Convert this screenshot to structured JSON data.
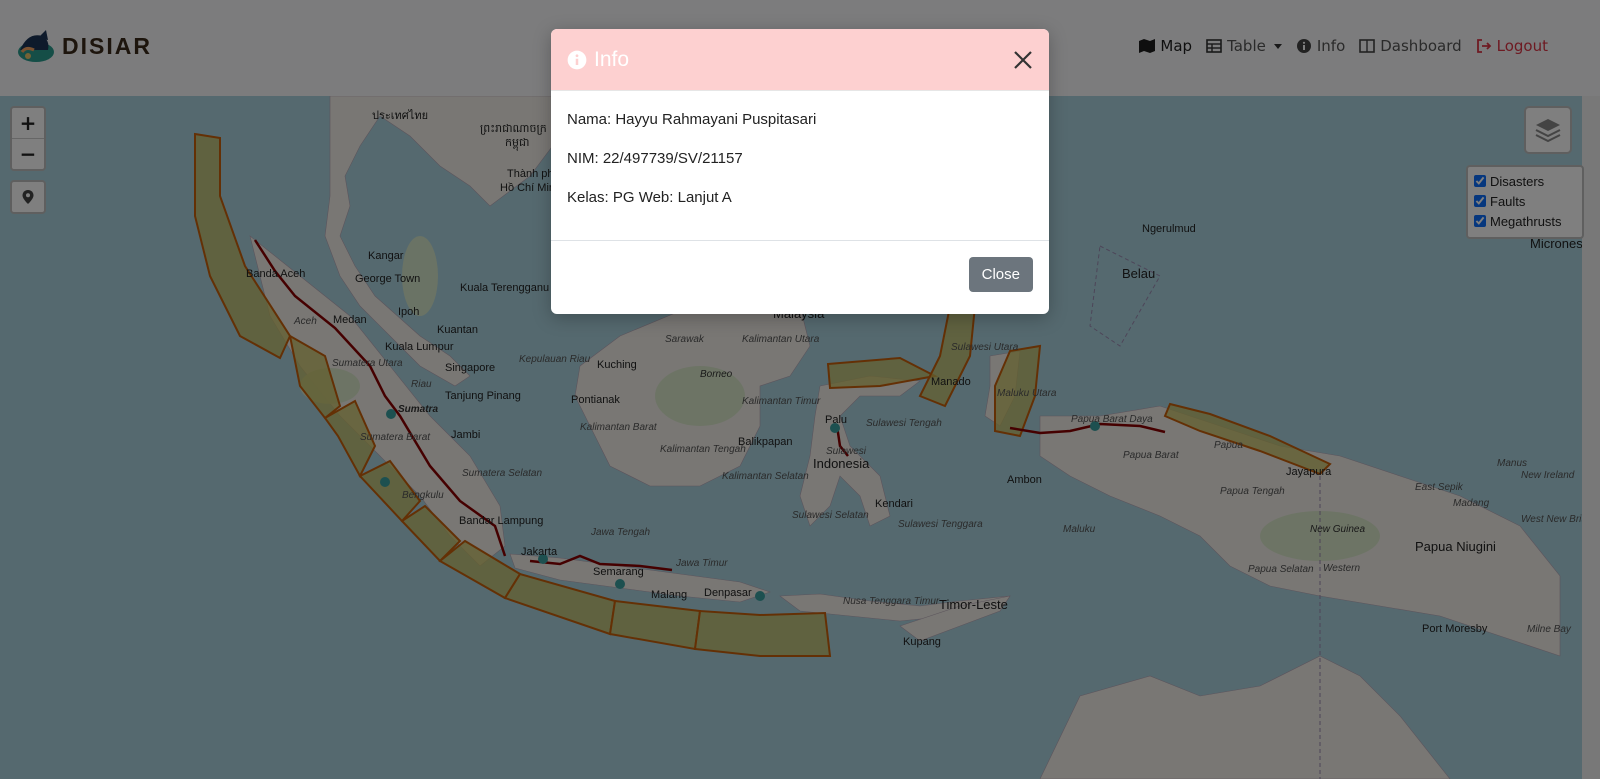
{
  "brand": {
    "name": "DISIAR"
  },
  "nav": {
    "items": [
      {
        "label": "Map",
        "icon": "map-icon"
      },
      {
        "label": "Table",
        "icon": "table-icon"
      },
      {
        "label": "Info",
        "icon": "info-circle-icon"
      },
      {
        "label": "Dashboard",
        "icon": "dashboard-icon"
      },
      {
        "label": "Logout",
        "icon": "logout-icon"
      }
    ]
  },
  "map": {
    "zoom_in": "+",
    "zoom_out": "−",
    "layers": [
      {
        "label": "Disasters",
        "checked": true
      },
      {
        "label": "Faults",
        "checked": true
      },
      {
        "label": "Megathrusts",
        "checked": true
      }
    ],
    "labels": {
      "thailand": "ประเทศไทย",
      "cambodia": "ព្រះរាជាណាចក្រ",
      "cambodia2": "កម្ពុជា",
      "hcm": "Thành phố",
      "hcm2": "Hồ Chí Minh",
      "banda_aceh": "Banda Aceh",
      "aceh_prov": "Aceh",
      "kangar": "Kangar",
      "george_town": "George Town",
      "ipoh": "Ipoh",
      "kuala_terengganu": "Kuala Terengganu",
      "medan": "Medan",
      "kuantan": "Kuantan",
      "kuala_lumpur": "Kuala Lumpur",
      "sumatera_utara": "Sumatera Utara",
      "singapore": "Singapore",
      "riau": "Riau",
      "kepulauan_riau": "Kepulauan Riau",
      "tanjung_pinang": "Tanjung Pinang",
      "sumatra": "Sumatra",
      "jambi": "Jambi",
      "sumatera_barat": "Sumatera Barat",
      "bengkulu": "Bengkulu",
      "sumatera_selatan": "Sumatera Selatan",
      "bandar_lampung": "Bandar Lampung",
      "jakarta": "Jakarta",
      "jawa_tengah": "Jawa Tengah",
      "semarang": "Semarang",
      "jawa_timur": "Jawa Timur",
      "malang": "Malang",
      "denpasar": "Denpasar",
      "kuching": "Kuching",
      "sarawak": "Sarawak",
      "borneo": "Borneo",
      "pontianak": "Pontianak",
      "kalimantan_barat": "Kalimantan Barat",
      "kalimantan_tengah": "Kalimantan Tengah",
      "kalimantan_timur": "Kalimantan Timur",
      "kalimantan_selatan": "Kalimantan Selatan",
      "kalimantan_utara": "Kalimantan Utara",
      "balikpapan": "Balikpapan",
      "malaysia": "Malaysia",
      "palu": "Palu",
      "sulawesi_tengah": "Sulawesi Tengah",
      "sulawesi_utara": "Sulawesi Utara",
      "sulawesi": "Sulawesi",
      "indonesia": "Indonesia",
      "kendari": "Kendari",
      "sulawesi_selatan": "Sulawesi Selatan",
      "sulawesi_tenggara": "Sulawesi Tenggara",
      "nusa_tenggara_timur": "Nusa Tenggara Timur",
      "timor_leste": "Timor-Leste",
      "kupang": "Kupang",
      "manado": "Manado",
      "maluku_utara": "Maluku Utara",
      "ambon": "Ambon",
      "maluku": "Maluku",
      "papua_barat_daya": "Papua Barat Daya",
      "papua_barat": "Papua Barat",
      "papua": "Papua",
      "papua_tengah": "Papua Tengah",
      "papua_selatan": "Papua Selatan",
      "jayapura": "Jayapura",
      "new_guinea": "New Guinea",
      "papua_niugini": "Papua Niugini",
      "western": "Western",
      "port_moresby": "Port Moresby",
      "east_sepik": "East Sepik",
      "madang": "Madang",
      "manus": "Manus",
      "new_ireland": "New Ireland",
      "west_new_britain": "West New Britain",
      "milne_bay": "Milne Bay",
      "ngerulmud": "Ngerulmud",
      "belau": "Belau",
      "micronesia": "Micrones"
    }
  },
  "modal": {
    "title": "Info",
    "lines": [
      "Nama: Hayyu Rahmayani Puspitasari",
      "NIM: 22/497739/SV/21157",
      "Kelas: PG Web: Lanjut A"
    ],
    "close_label": "Close"
  },
  "colors": {
    "modal_header": "#fdd0d0",
    "megathrust_fill": "#c8c060",
    "megathrust_stroke": "#c8600a",
    "fault_line": "#8b0000",
    "water": "#aad3df",
    "land": "#f2efe9",
    "logout": "#dc3545"
  }
}
